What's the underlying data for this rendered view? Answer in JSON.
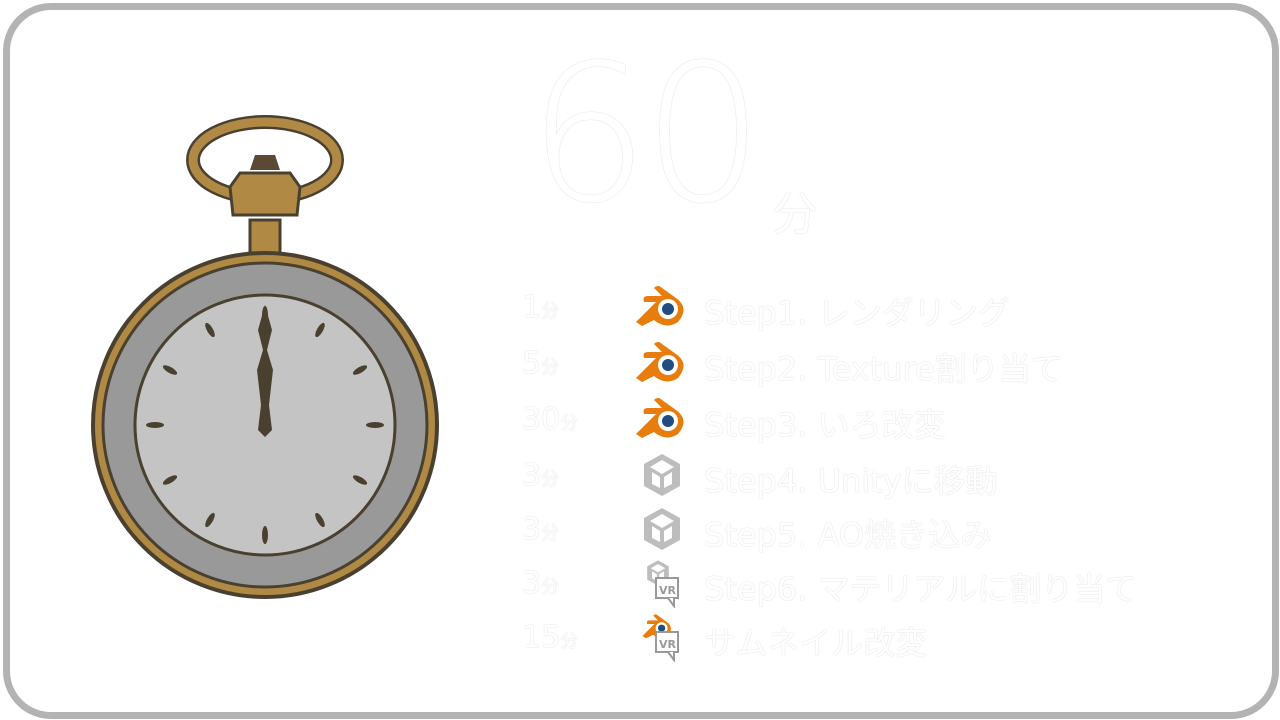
{
  "total": {
    "value": "60",
    "unit": "分"
  },
  "steps": [
    {
      "minutes": "1",
      "unit": "分",
      "icon": "blender-icon",
      "label": "Step1. レンダリング"
    },
    {
      "minutes": "5",
      "unit": "分",
      "icon": "blender-icon",
      "label": "Step2. Texture割り当て"
    },
    {
      "minutes": "30",
      "unit": "分",
      "icon": "blender-icon",
      "label": "Step3. いろ改変"
    },
    {
      "minutes": "3",
      "unit": "分",
      "icon": "unity-icon",
      "label": "Step4. Unityに移動"
    },
    {
      "minutes": "3",
      "unit": "分",
      "icon": "unity-icon",
      "label": "Step5. AO焼き込み"
    },
    {
      "minutes": "3",
      "unit": "分",
      "icon": "unity-vr-icon",
      "label": "Step6. マテリアルに割り当て"
    },
    {
      "minutes": "15",
      "unit": "分",
      "icon": "blender-vr-icon",
      "label": "サムネイル改変"
    }
  ],
  "colors": {
    "blender": "#e87d0d",
    "blender_eye": "#1f4d80",
    "unity": "#bdbdbd",
    "frame": "#b3b3b3"
  }
}
